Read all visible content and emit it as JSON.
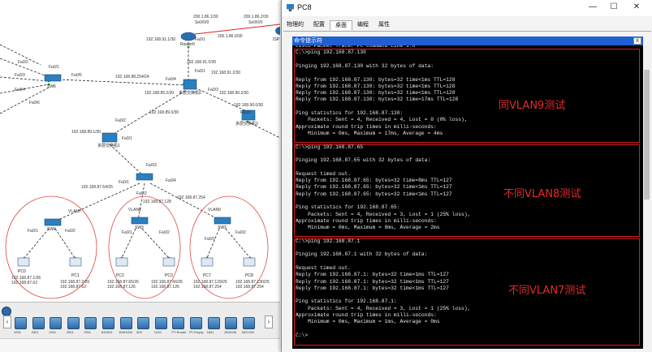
{
  "window": {
    "title": "PC8",
    "minimize": "—",
    "maximize": "☐",
    "close": "✕",
    "tabs": [
      "物理的",
      "配置",
      "桌面",
      "编程",
      "属性"
    ],
    "active_tab": "桌面"
  },
  "cmd_header": {
    "title": "命令提示符",
    "close": "X"
  },
  "cmd_lines": [
    "Cisco Packet Tracer PC Command Line 1.0",
    "C:\\>ping 192.168.87.130",
    "",
    "Pinging 192.168.87.130 with 32 bytes of data:",
    "",
    "Reply from 192.168.87.130: bytes=32 time<1ms TTL=128",
    "Reply from 192.168.87.130: bytes=32 time<1ms TTL=128",
    "Reply from 192.168.87.130: bytes=32 time<1ms TTL=128",
    "Reply from 192.168.87.130: bytes=32 time=17ms TTL=128",
    "",
    "Ping statistics for 192.168.87.130:",
    "    Packets: Sent = 4, Received = 4, Lost = 0 (0% loss),",
    "Approximate round trip times in milli-seconds:",
    "    Minimum = 0ms, Maximum = 17ms, Average = 4ms",
    "",
    "C:\\>ping 192.168.87.65",
    "",
    "Pinging 192.168.87.65 with 32 bytes of data:",
    "",
    "Request timed out.",
    "Reply from 192.168.87.65: bytes=32 time=8ms TTL=127",
    "Reply from 192.168.87.65: bytes=32 time<1ms TTL=127",
    "Reply from 192.168.87.65: bytes=32 time<1ms TTL=127",
    "",
    "Ping statistics for 192.168.87.65:",
    "    Packets: Sent = 4, Received = 3, Lost = 1 (25% loss),",
    "Approximate round trip times in milli-seconds:",
    "    Minimum = 0ms, Maximum = 8ms, Average = 2ms",
    "",
    "C:\\>ping 192.168.87.1",
    "",
    "Pinging 192.168.87.1 with 32 bytes of data:",
    "",
    "Request timed out.",
    "Reply from 192.168.87.1: bytes=32 time=1ms TTL=127",
    "Reply from 192.168.87.1: bytes=32 time<1ms TTL=127",
    "Reply from 192.168.87.1: bytes=32 time<1ms TTL=127",
    "",
    "Ping statistics for 192.168.87.1:",
    "    Packets: Sent = 4, Received = 3, Lost = 1 (25% loss),",
    "Approximate round trip times in milli-seconds:",
    "    Minimum = 0ms, Maximum = 1ms, Average = 0ms",
    "",
    "C:\\>"
  ],
  "annotations": [
    "同VLAN9测试",
    "不同VLAN8测试",
    "不同VLAN7测试"
  ],
  "annotation_color": "#e52a2a",
  "topology": {
    "devices": {
      "router0": "Router0",
      "isp": "ISP",
      "sw6": "SW6",
      "core0": "多层交换机0",
      "core2": "多层交换机2",
      "sw_mid": "多层交换机1",
      "sw_left": "SW4",
      "sw_center": "SW3",
      "sw_right": "SW3",
      "pc0": "PC0",
      "pc1": "PC1",
      "pc2": "PC2",
      "pc3": "PC3",
      "pc7": "PC7",
      "pc8": "PC8"
    },
    "labels": {
      "r_ip1": "200.1.86.1/30",
      "r_if1": "Se0/0/0",
      "r_ip2": "200.1.86.2/30",
      "r_if2": "Se0/0/0",
      "r_ip3": "200.1.86.0/30",
      "r_ip4": "192.168.91.1/30",
      "r_if3": "Fa0/1",
      "net1": "192.168.91.0/30",
      "net2": "192.168.91.2/30",
      "net3": "192.168.88.254/24",
      "net4": "192.168.89.2/30",
      "net5": "192.168.90.2/30",
      "net6": "192.168.90.0/30",
      "net7": "192.168.89.0/30",
      "net8": "192.168.89.1/30",
      "net9": "192.168.87.64/25",
      "net10": "192.168.87.128",
      "net11": "192.168.87.254",
      "vlan7": "VLAN7",
      "vlan8": "VLAN8",
      "vlan9": "VLAN9",
      "pc0_ip": "192.168.87.1/26\n192.168.87.62",
      "pc1_ip": "192.168.87.2/26\n192.168.87.62",
      "pc2_ip": "192.168.87.65/26\n192.168.87.126",
      "pc3_ip": "192.168.87.66/26\n192.168.87.126",
      "pc7_ip": "192.168.87.129/25\n192.168.87.254",
      "pc8_ip": "192.168.87.130/25\n192.168.87.254",
      "fa02a": "Fa0/2",
      "fa03a": "Fa0/3",
      "fa04a": "Fa0/4",
      "fa06a": "Fa0/6",
      "fa01a": "Fa0/1",
      "fa05a": "Fa0/5",
      "fa01b": "Fa0/1",
      "fa03b": "Fa0/3",
      "fa04b": "Fa0/4",
      "fa02b": "Fa0/2",
      "fa01c": "Fa0/1",
      "fa03c": "Fa0/3",
      "fa01d": "Fa0/1",
      "fa02c": "Fa0/2",
      "fa04c": "Fa0/4",
      "fa03d": "Fa0/3",
      "fa01e": "Fa0/1",
      "fa02d": "Fa0/2",
      "fa01f": "Fa0/1",
      "fa02e": "Fa0/2",
      "fa01g": "Fa0/1",
      "fa02f": "Fa0/2"
    }
  },
  "toolbar": {
    "devices": [
      "4331",
      "4321",
      "1941",
      "2901",
      "2911",
      "819IOX",
      "819HGW",
      "829",
      "1240",
      "PT-Router",
      "PT-Empty",
      "1841",
      "2620XM",
      "2621XM"
    ]
  }
}
